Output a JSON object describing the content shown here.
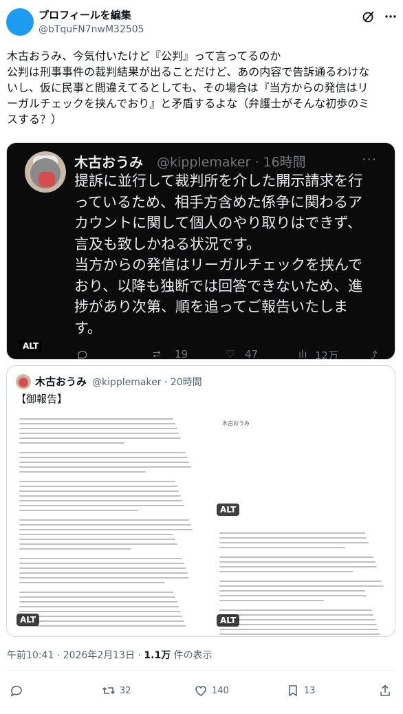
{
  "header": {
    "display_name": "プロフィールを編集",
    "handle": "@bTquFN7nwM32505"
  },
  "post": {
    "lines": [
      "木古おうみ、今気付いたけど『公判』って言ってるのか",
      "公判は刑事事件の裁判結果が出ることだけど、あの内容で告訴通るわけな\nいし、仮に民事と間違えてるとしても、その場合は『当方からの発信はリ\nーガルチェックを挟んでおり』と矛盾するよな（弁護士がそんな初歩のミ\nスする？）"
    ]
  },
  "media1": {
    "name": "木古おうみ",
    "handle": "@kipplemaker · 16時間",
    "more": "···",
    "body": [
      "提訴に並行して裁判所を介した開示請求を行\nっているため、相手方含めた係争に関わるア\nカウントに関して個人のやり取りはできず、\n言及も致しかねる状況です。",
      "当方からの発信はリーガルチェックを挟んで\nおり、以降も独断では回答できないため、進\n捗があり次第、順を追ってご報告いたしま\nす。"
    ],
    "counts": {
      "retweets": "19",
      "likes": "47",
      "views": "12万"
    },
    "alt": "ALT"
  },
  "quote": {
    "name": "木古おうみ",
    "handle": "@kipplemaker · 20時間",
    "text": "【御報告】",
    "doc_title": "木古おうみ",
    "alt": "ALT"
  },
  "meta": {
    "time": "午前10:41 · 2026年2月13日 · ",
    "views": "1.1万",
    "views_suffix": " 件の表示"
  },
  "actions": {
    "reply": "",
    "retweet": "32",
    "like": "140",
    "bookmark": "13"
  }
}
